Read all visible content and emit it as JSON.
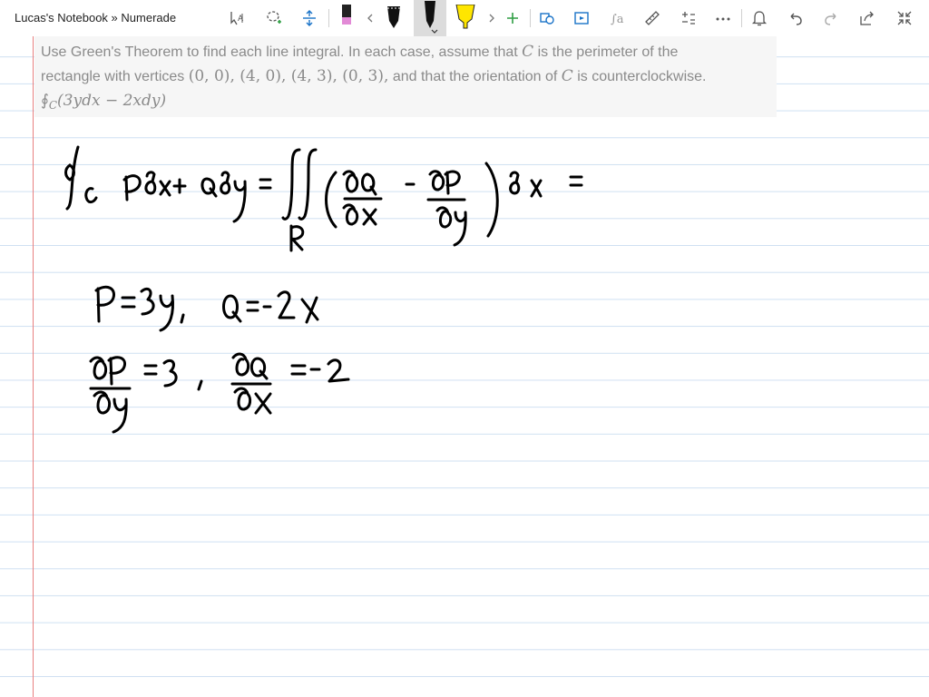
{
  "window": {
    "title": "Lucas's Notebook » Numerade"
  },
  "toolbar": {
    "icons": [
      "select-text-icon",
      "lasso-select-icon",
      "insert-space-icon",
      "pen-pink-icon",
      "chevron-left-icon",
      "pen-black-icon",
      "pen-dark-active-icon",
      "highlighter-yellow-icon",
      "chevron-right-icon",
      "add-pen-icon",
      "ink-to-shape-icon",
      "ink-replay-icon",
      "ink-to-math-icon",
      "ruler-icon",
      "math-icon",
      "more-icon",
      "bell-icon",
      "undo-icon",
      "redo-icon",
      "share-icon",
      "fullscreen-icon"
    ],
    "colors": {
      "pink_pen": "#e28ad6",
      "highlighter": "#ffe600",
      "accent_blue": "#1a73c8",
      "accent_green": "#2f9e44"
    }
  },
  "question": {
    "line1_text": "Use Green's Theorem to find each line integral. In each case, assume that ",
    "line1_var": "C",
    "line1_end": " is the perimeter of the",
    "line2_start": "rectangle with vertices ",
    "vertices": "(0, 0), (4, 0), (4, 3), (0, 3),",
    "line2_mid": " and that the orientation of ",
    "line2_var": "C",
    "line2_end": " is counterclockwise.",
    "integral": "∮",
    "integral_sub": "C",
    "integrand": "(3ydx − 2xdy)"
  },
  "handwriting": {
    "line1": "∮C Pdx + Qdy = ∬R (∂Q/∂x − ∂P/∂y) dx =",
    "line2": "P = 3y, Q = -2x",
    "line3": "∂P/∂y = 3, ∂Q/∂x = -2"
  },
  "page": {
    "rule_color": "#cfe0f2",
    "margin_color": "#e88080",
    "question_bg": "#f6f6f6"
  }
}
